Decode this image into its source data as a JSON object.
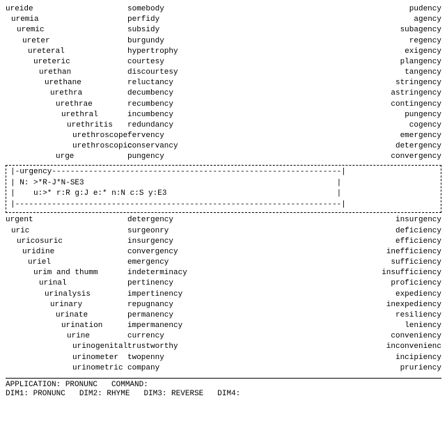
{
  "columns": {
    "top": {
      "left": [
        {
          "text": "ureide",
          "indent": 0
        },
        {
          "text": "uremia",
          "indent": 1
        },
        {
          "text": "uremic",
          "indent": 2
        },
        {
          "text": "ureter",
          "indent": 3
        },
        {
          "text": "ureteral",
          "indent": 4
        },
        {
          "text": "ureteric",
          "indent": 5
        },
        {
          "text": "urethan",
          "indent": 6
        },
        {
          "text": "urethane",
          "indent": 7
        },
        {
          "text": "urethra",
          "indent": 8
        },
        {
          "text": "urethrae",
          "indent": 9
        },
        {
          "text": "urethral",
          "indent": 10
        },
        {
          "text": "urethritis",
          "indent": 11
        },
        {
          "text": "urethroscope",
          "indent": 12
        },
        {
          "text": "urethroscopic",
          "indent": 12
        },
        {
          "text": "urge",
          "indent": 9
        }
      ],
      "mid": [
        {
          "text": "somebody"
        },
        {
          "text": "perfidy"
        },
        {
          "text": "subsidy"
        },
        {
          "text": "burgundy"
        },
        {
          "text": "hypertrophy"
        },
        {
          "text": "courtesy"
        },
        {
          "text": "discourtesy"
        },
        {
          "text": "reluctancy"
        },
        {
          "text": "decumbency"
        },
        {
          "text": "recumbency"
        },
        {
          "text": "incumbency"
        },
        {
          "text": "redundancy"
        },
        {
          "text": "fervency"
        },
        {
          "text": "conservancy"
        },
        {
          "text": "pungency"
        }
      ],
      "right": [
        {
          "text": "pudency"
        },
        {
          "text": "agency"
        },
        {
          "text": "subagency"
        },
        {
          "text": "regency"
        },
        {
          "text": "exigency"
        },
        {
          "text": "plangency"
        },
        {
          "text": "tangency"
        },
        {
          "text": "stringency"
        },
        {
          "text": "astringency"
        },
        {
          "text": "contingency"
        },
        {
          "text": "pungency"
        },
        {
          "text": "cogency"
        },
        {
          "text": "emergency"
        },
        {
          "text": "detergency"
        },
        {
          "text": "convergency"
        }
      ]
    },
    "box": {
      "line1": "|-urgency-",
      "line2": "N: >*R-J*N-SE3",
      "line3": "   u:>* r:R g:J e:* n:N c:S y:E3",
      "line4": "|-"
    },
    "bottom": {
      "left": [
        {
          "text": "urgent"
        },
        {
          "text": "uric"
        },
        {
          "text": "uricosuric"
        },
        {
          "text": "uridine"
        },
        {
          "text": "uriel"
        },
        {
          "text": "urim and thumm"
        },
        {
          "text": "urinal"
        },
        {
          "text": "urinalysis"
        },
        {
          "text": "urinary"
        },
        {
          "text": "urinate"
        },
        {
          "text": "urination"
        },
        {
          "text": "urine"
        },
        {
          "text": "urinogenital"
        },
        {
          "text": "urinometer"
        },
        {
          "text": "urinometric"
        }
      ],
      "mid": [
        {
          "text": "detergency"
        },
        {
          "text": "surgeonry"
        },
        {
          "text": "insurgency"
        },
        {
          "text": "convergency"
        },
        {
          "text": "emergency"
        },
        {
          "text": "indeterminacy"
        },
        {
          "text": "pertinency"
        },
        {
          "text": "impertinency"
        },
        {
          "text": "repugnancy"
        },
        {
          "text": "permanency"
        },
        {
          "text": "impermanency"
        },
        {
          "text": "currency"
        },
        {
          "text": "trustworthy"
        },
        {
          "text": "twopenny"
        },
        {
          "text": "company"
        }
      ],
      "right": [
        {
          "text": "insurgency"
        },
        {
          "text": "deficiency"
        },
        {
          "text": "efficiency"
        },
        {
          "text": "inefficiency"
        },
        {
          "text": "sufficiency"
        },
        {
          "text": "insufficiency"
        },
        {
          "text": "proficiency"
        },
        {
          "text": "expediency"
        },
        {
          "text": "inexpediency"
        },
        {
          "text": "resiliency"
        },
        {
          "text": "leniency"
        },
        {
          "text": "conveniency"
        },
        {
          "text": "inconvenienc"
        },
        {
          "text": "incipiency"
        },
        {
          "text": "pruriency"
        }
      ]
    }
  },
  "statusBar": {
    "line1_label1": "APPLICATION:",
    "line1_val1": "PRONUNC",
    "line1_label2": "COMMAND:",
    "line1_val2": "",
    "line2_label1": "DIM1:",
    "line2_val1": "PRONUNC",
    "line2_label2": "DIM2:",
    "line2_val2": "RHYME",
    "line2_label3": "DIM3:",
    "line2_val3": "REVERSE",
    "line2_label4": "DIM4:",
    "line2_val4": ""
  }
}
